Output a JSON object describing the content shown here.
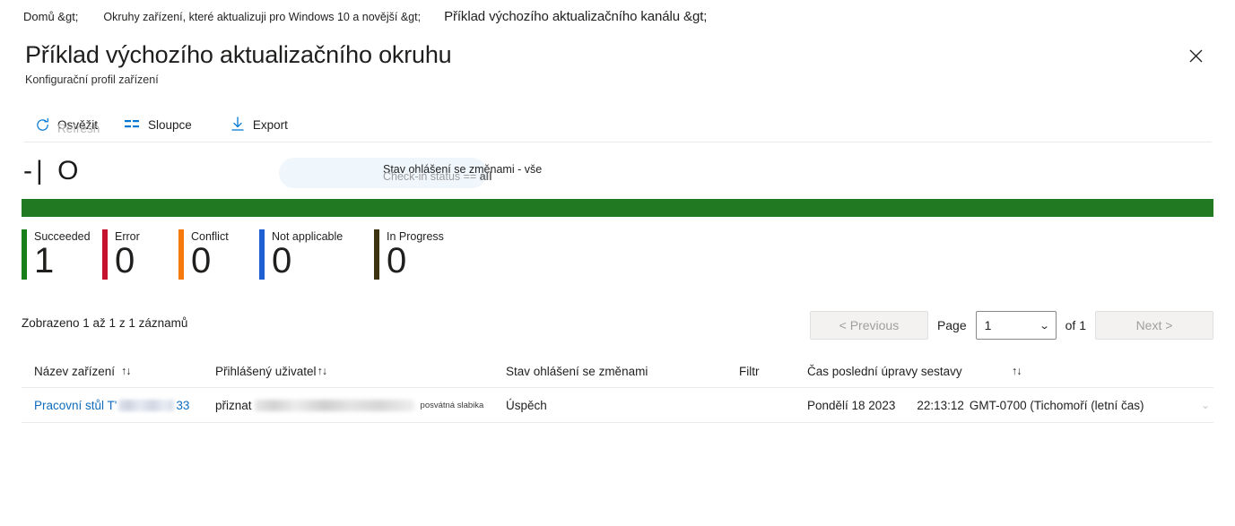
{
  "breadcrumb": {
    "home": "Domů &gt;",
    "middle": "Okruhy zařízení, které aktualizuji pro Windows 10 a novější &gt;",
    "current": "Příklad výchozího aktualizačního kanálu &gt;"
  },
  "header": {
    "title": "Příklad výchozího aktualizačního okruhu",
    "subtitle": "Konfigurační profil zařízení",
    "close_icon": "close-icon"
  },
  "toolbar": {
    "refresh_label": "Osvěžit",
    "refresh_ghost": "Refresh",
    "refresh_icon": "refresh-icon",
    "columns_label": "Sloupce",
    "columns_icon": "columns-icon",
    "export_label": "Export",
    "export_icon": "download-icon"
  },
  "filter": {
    "left_glyph": "-| O",
    "chip_cz": "Stav ohlášení se změnami - vše",
    "chip_en_prefix": "Check-in status ==",
    "chip_en_bold": "all"
  },
  "status": {
    "bar_color": "#217a21",
    "tiles": [
      {
        "label": "Succeeded",
        "value": "1",
        "color": "#197f19"
      },
      {
        "label": "Error",
        "value": "0",
        "color": "#c4122f"
      },
      {
        "label": "Conflict",
        "value": "0",
        "color": "#f7790b"
      },
      {
        "label": "Not applicable",
        "value": "0",
        "color": "#1f5fd4"
      },
      {
        "label": "In Progress",
        "value": "0",
        "color": "#3d3311"
      }
    ]
  },
  "results": {
    "count_text": "Zobrazeno 1 až 1 z 1 záznamů",
    "previous_label": "< Previous",
    "page_label": "Page",
    "page_value": "1",
    "of_label": "of 1",
    "next_label": "Next >",
    "chevron_icon": "chevron-down-icon"
  },
  "table": {
    "columns": [
      {
        "label": "Název zařízení",
        "sort": "↑↓"
      },
      {
        "label": "Přihlášený uživatel",
        "sort": "↑↓"
      },
      {
        "label": "Stav ohlášení se změnami",
        "sort": ""
      },
      {
        "label": "Filtr",
        "sort": ""
      },
      {
        "label": "Čas poslední úpravy sestavy",
        "sort": "↑↓"
      }
    ],
    "rows": [
      {
        "device_prefix": "Pracovní stůl T'",
        "device_suffix": "33",
        "user_prefix": "přiznat",
        "user_note": "posvátná slabika",
        "status": "Úspěch",
        "filter": "",
        "time_date": "Pondělí 18 2023",
        "time_clock": "22:13:12",
        "time_zone": "GMT-0700 (Tichomoří (letní čas)"
      }
    ]
  }
}
